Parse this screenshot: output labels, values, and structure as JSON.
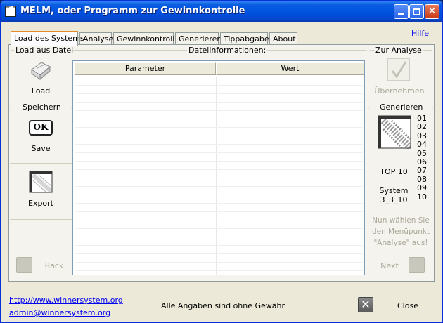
{
  "window": {
    "title": "MELM, oder Programm zur Gewinnkontrolle",
    "icon_text": "MELM"
  },
  "help_link": "Hilfe",
  "tabs": [
    {
      "label": "Load des Systems",
      "active": true
    },
    {
      "label": "Analyse"
    },
    {
      "label": "Gewinnkontrolle"
    },
    {
      "label": "Generieren"
    },
    {
      "label": "Tippabgabe"
    },
    {
      "label": "About"
    }
  ],
  "left_panel": {
    "load_group": "Load aus Datei",
    "load_label": "Load",
    "save_group": "Speichern",
    "save_icon_text": "OK",
    "save_label": "Save",
    "export_label": "Export",
    "back_label": "Back"
  },
  "file_info": {
    "group_label": "Dateiinformationen:",
    "columns": [
      "Parameter",
      "Wert"
    ],
    "rows": []
  },
  "right_panel": {
    "analyse_group": "Zur Analyse",
    "apply_label": "Übernehmen",
    "generate_group": "Generieren",
    "numbers": [
      "01",
      "02",
      "03",
      "04",
      "05",
      "06",
      "07",
      "08",
      "09",
      "10"
    ],
    "top10_label": "TOP 10",
    "system_label_line1": "System",
    "system_label_line2": "3_3_10",
    "hint_line1": "Nun wählen Sie",
    "hint_line2": "den Menüpunkt",
    "hint_line3": "\"Analyse\" aus!",
    "next_label": "Next"
  },
  "footer": {
    "website": "http://www.winnersystem.org",
    "email": "admin@winnersystem.org",
    "disclaimer": "Alle Angaben sind ohne Gewähr",
    "close_label": "Close"
  }
}
